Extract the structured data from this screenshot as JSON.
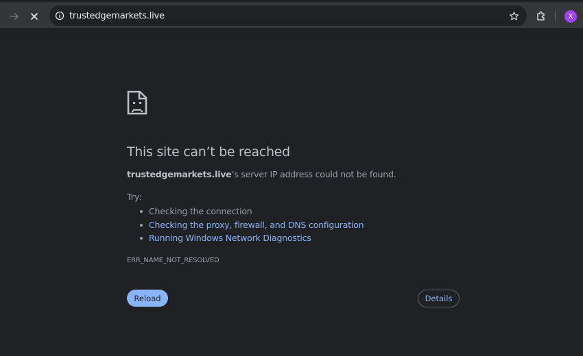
{
  "browser": {
    "url": "trustedgemarkets.live",
    "avatar_letter": "X",
    "accent": "#8ab4f8",
    "avatar_color": "#a142f4"
  },
  "error_page": {
    "title": "This site can’t be reached",
    "host": "trustedgemarkets.live",
    "description_suffix": "’s server IP address could not be found.",
    "try_label": "Try:",
    "suggestions": [
      "Checking the connection",
      "Checking the proxy, firewall, and DNS configuration",
      "Running Windows Network Diagnostics"
    ],
    "error_code": "ERR_NAME_NOT_RESOLVED",
    "reload_label": "Reload",
    "details_label": "Details"
  }
}
